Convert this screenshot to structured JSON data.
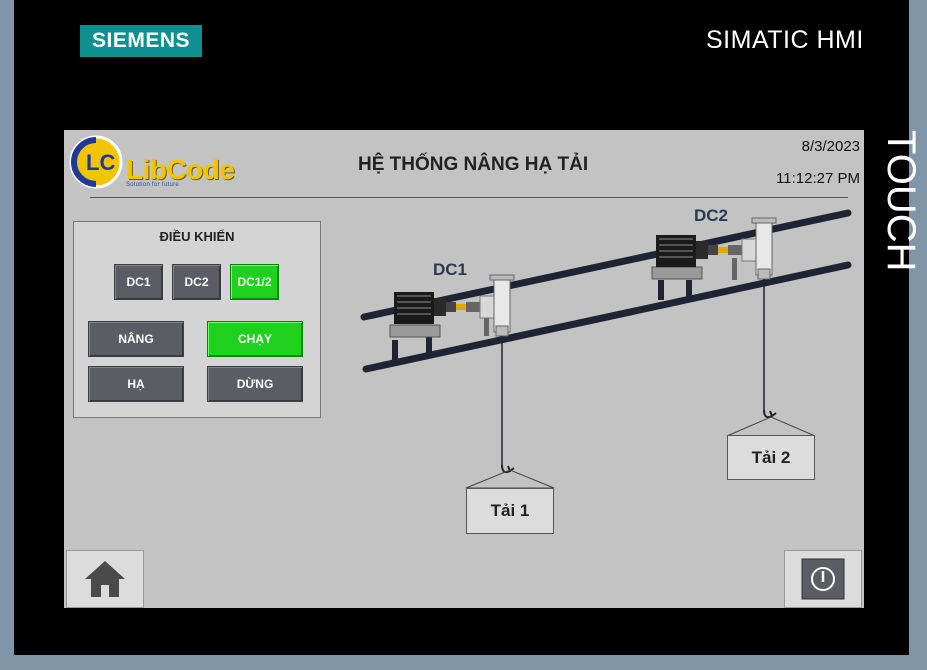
{
  "device": {
    "brand": "SIEMENS",
    "model": "SIMATIC HMI",
    "side_label": "TOUCH"
  },
  "header": {
    "logo_text": "LibCode",
    "logo_tagline": "Solution for future",
    "title": "HỆ THỐNG NÂNG HẠ TẢI",
    "date": "8/3/2023",
    "time": "11:12:27 PM"
  },
  "control_panel": {
    "title": "ĐIỀU KHIỂN",
    "motor_select": [
      {
        "label": "DC1",
        "active": false
      },
      {
        "label": "DC2",
        "active": false
      },
      {
        "label": "DC1/2",
        "active": true
      }
    ],
    "buttons": {
      "raise": "NÂNG",
      "run": "CHẠY",
      "lower": "HẠ",
      "stop": "DỪNG"
    }
  },
  "scene": {
    "motor1_label": "DC1",
    "motor2_label": "DC2",
    "load1_label": "Tải 1",
    "load2_label": "Tải 2"
  },
  "colors": {
    "screen_bg": "#c3c3c3",
    "button_gray": "#5a5e64",
    "button_active": "#1fd01f",
    "rail": "#1e2433"
  },
  "icons": {
    "home": "home-icon",
    "power": "power-icon"
  }
}
